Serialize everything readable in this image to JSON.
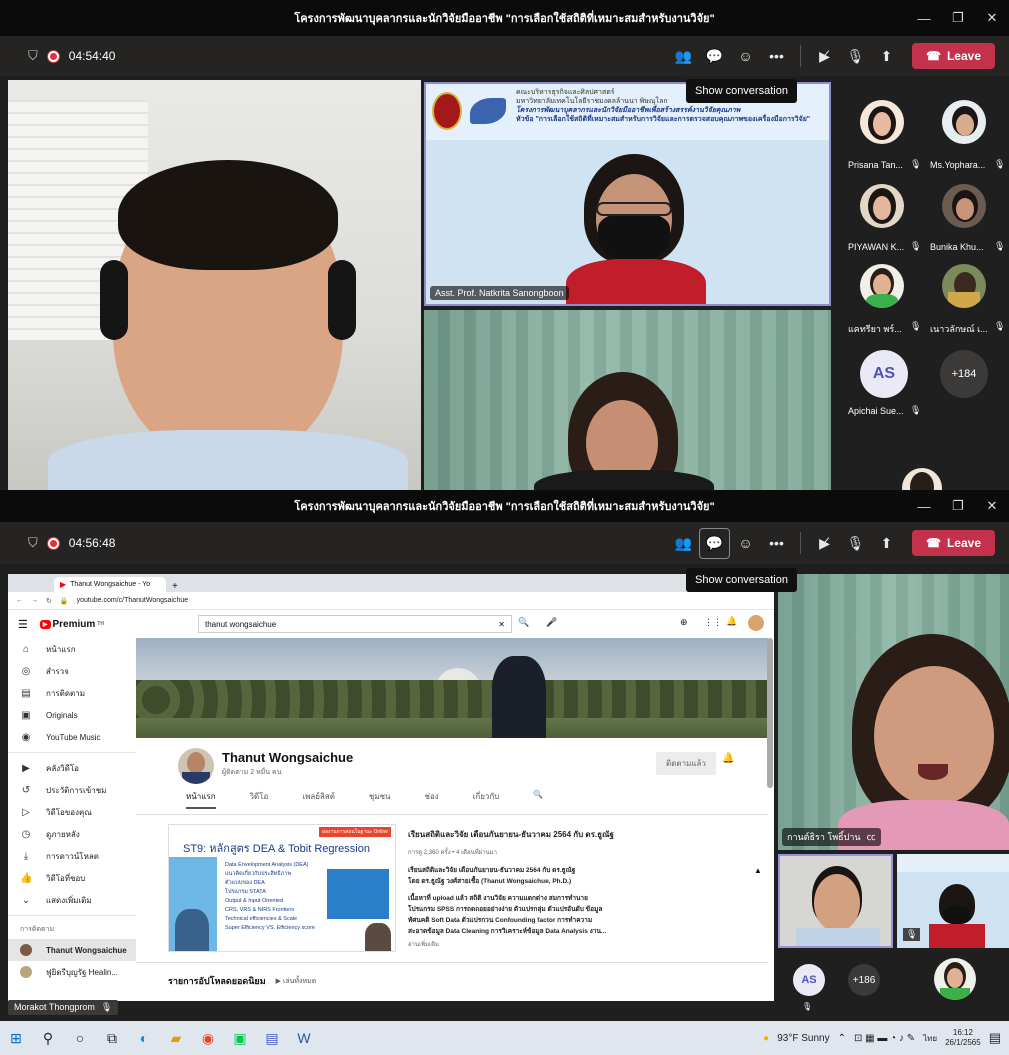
{
  "window": {
    "title": "โครงการพัฒนาบุคลากรและนักวิจัยมืออาชีพ \"การเลือกใช้สถิติที่เหมาะสมสำหรับงานวิจัย\"",
    "min": "—",
    "max": "❐",
    "close": "✕"
  },
  "top": {
    "timer": "04:54:40",
    "tooltip": "Show conversation",
    "leave": "Leave",
    "presenter_tag": "Asst. Prof. Natkrita Sanongboon",
    "slide_lines": [
      "คณะบริหารธุรกิจและศิลปศาสตร์",
      "มหาวิทยาลัยเทคโนโลยีราชมงคลล้านนา พิษณุโลก",
      "โครงการพัฒนาบุคลากรและนักวิจัยมืออาชีพเพื่อสร้างสรรค์งานวิจัยคุณภาพ",
      "หัวข้อ \"การเลือกใช้สถิติที่เหมาะสมสำหรับการวิจัยและการตรวจสอบคุณภาพของเครื่องมือการวิจัย\""
    ],
    "participants": [
      {
        "name": "Prisana Tan..."
      },
      {
        "name": "Ms.Yophara..."
      },
      {
        "name": "PIYAWAN K..."
      },
      {
        "name": "Bunika Khu..."
      },
      {
        "name": "แคทรียา พร์..."
      },
      {
        "name": "เนาวลักษณ์ เ..."
      },
      {
        "name": "Apichai Sue...",
        "initials": "AS"
      }
    ],
    "more": "+184"
  },
  "bottom": {
    "timer": "04:56:48",
    "tooltip": "Show conversation",
    "leave": "Leave",
    "speaker_tag": "กานต์ธิรา โพธิ์ปาน",
    "self_tag": "Morakot Thongprom",
    "more": "+186",
    "as_initials": "AS"
  },
  "browser": {
    "tab": "Thanut Wongsaichue - Yo",
    "url": "youtube.com/c/ThanutWongsaichue",
    "search": "thanut wongsaichue",
    "logo": "Premium",
    "logo_sup": "TH",
    "sidebar": [
      "หน้าแรก",
      "สำรวจ",
      "การติดตาม",
      "Originals",
      "YouTube Music",
      "คลังวิดีโอ",
      "ประวัติการเข้าชม",
      "วิดีโอของคุณ",
      "ดูภายหลัง",
      "การดาวน์โหลด",
      "วิดีโอที่ชอบ",
      "แสดงเพิ่มเติม"
    ],
    "sidebar_section": "การติดตาม",
    "subs": [
      "Thanut Wongsaichue",
      "ฟูยิตรีบุญรัฐ Healin..."
    ],
    "channel_name": "Thanut Wongsaichue",
    "channel_subs": "ผู้ติดตาม 2 หมื่น คน",
    "subscribed": "ติดตามแล้ว",
    "tabs": [
      "หน้าแรก",
      "วิดีโอ",
      "เพลย์ลิสต์",
      "ชุมชน",
      "ช่อง",
      "เกี่ยวกับ"
    ],
    "video_title": "เรียนสถิติและวิจัย เดือนกันยายน-ธันวาคม 2564 กับ ดร.ธูณัฐ",
    "video_meta": "การดู 2,360 ครั้ง • 4 เดือนที่ผ่านมา",
    "video_desc": [
      "เรียนสถิติและวิจัย เดือนกันยายน-ธันวาคม 2564 กับ ดร.ธูณัฐ",
      "โดย ดร.ธูณัฐ วงศ์สายเชื้อ (Thanut Wongsaichue, Ph.D.)",
      "",
      "เนื้อหาที่ upload แล้ว สถิติ งานวิจัย ความแตกต่าง สมการทำนาย",
      "โปรแกรม SPSS การถดถอยอย่างง่าย ตัวแปรกลุ่ม ตัวแปรอันดับ ข้อมูล",
      "ทัศนคติ Soft Data ตัวแปรกวน Confounding factor การทำความ",
      "สะอาดข้อมูล Data Cleaning การวิเคราะห์ข้อมูล Data Analysis งาน..."
    ],
    "read_more": "อ่านเพิ่มเติม",
    "thumb_title": "ST9: หลักสูตร DEA & Tobit Regression",
    "thumb_badge": "ผลงานการสอนในฐานะ Online",
    "thumb_items": [
      "Data Envelopment Analysis (DEA)",
      "แนวคิดเกี่ยวกับประสิทธิภาพ",
      "ตัวแบบของ DEA",
      "โปรแกรม STATA",
      "Output & Input Oriented",
      "CRS, VRS & NIRS Frontiers",
      "Technical efficiencies & Scale",
      "Super Efficiency VS. Efficiency score"
    ],
    "popular": "รายการอัปโหลดยอดนิยม",
    "play_all": "เล่นทั้งหมด"
  },
  "taskbar": {
    "weather": "93°F  Sunny",
    "lang": "ไทย",
    "time": "16:12",
    "date": "26/1/2565"
  }
}
